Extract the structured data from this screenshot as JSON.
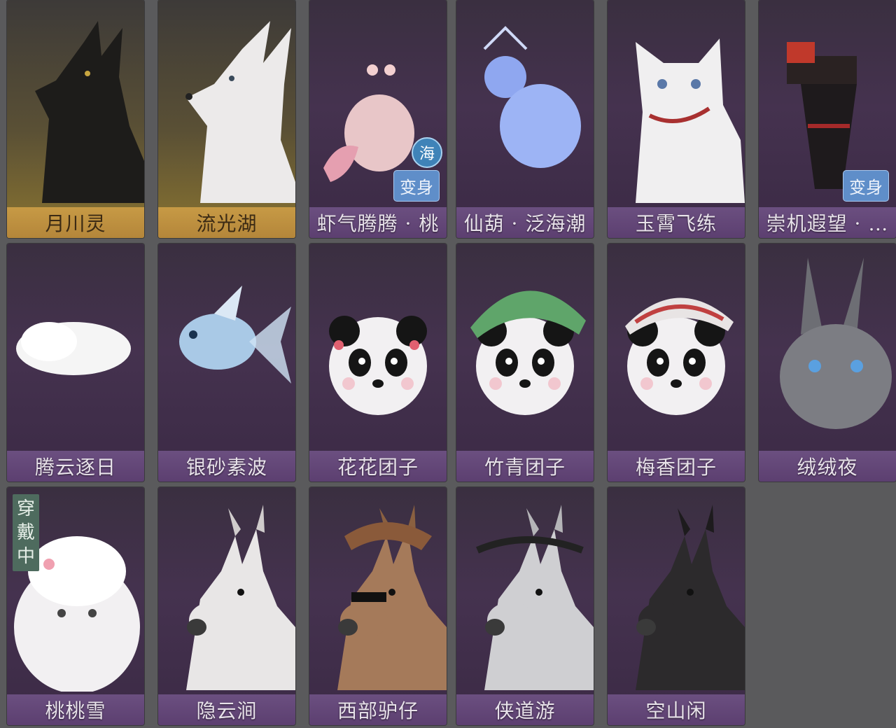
{
  "colors": {
    "purple_bar": "#6b4f80",
    "gold_bar": "#c79a45",
    "badge_blue": "#5f8ec9",
    "wearing_green": "#4e6b5e"
  },
  "cards": [
    {
      "name": "月川灵",
      "style": "gold",
      "icon": "black-fox-icon"
    },
    {
      "name": "流光湖",
      "style": "gold",
      "icon": "white-fox-icon"
    },
    {
      "name": "虾气腾腾 · 桃",
      "style": "purple",
      "icon": "shrimp-icon",
      "badge": "变身",
      "sea_badge": "海"
    },
    {
      "name": "仙葫 · 泛海潮",
      "style": "purple",
      "icon": "gourd-icon"
    },
    {
      "name": "玉霄飞练",
      "style": "purple",
      "icon": "white-cat-icon"
    },
    {
      "name": "崇机遐望 · …",
      "style": "purple",
      "icon": "mech-icon",
      "badge": "变身"
    },
    {
      "name": "腾云逐日",
      "style": "purple",
      "icon": "cloud-icon"
    },
    {
      "name": "银砂素波",
      "style": "purple",
      "icon": "goldfish-icon"
    },
    {
      "name": "花花团子",
      "style": "purple",
      "icon": "panda-icon"
    },
    {
      "name": "竹青团子",
      "style": "purple",
      "icon": "panda-green-hat-icon"
    },
    {
      "name": "梅香团子",
      "style": "purple",
      "icon": "panda-red-hat-icon"
    },
    {
      "name": "绒绒夜",
      "style": "purple",
      "icon": "gray-rabbit-icon"
    },
    {
      "name": "桃桃雪",
      "style": "purple",
      "icon": "white-furry-icon",
      "wearing": "穿戴中"
    },
    {
      "name": "隐云涧",
      "style": "purple",
      "icon": "white-donkey-icon"
    },
    {
      "name": "西部驴仔",
      "style": "purple",
      "icon": "cowboy-donkey-icon"
    },
    {
      "name": "侠道游",
      "style": "purple",
      "icon": "gray-donkey-icon"
    },
    {
      "name": "空山闲",
      "style": "purple",
      "icon": "black-donkey-icon"
    }
  ]
}
